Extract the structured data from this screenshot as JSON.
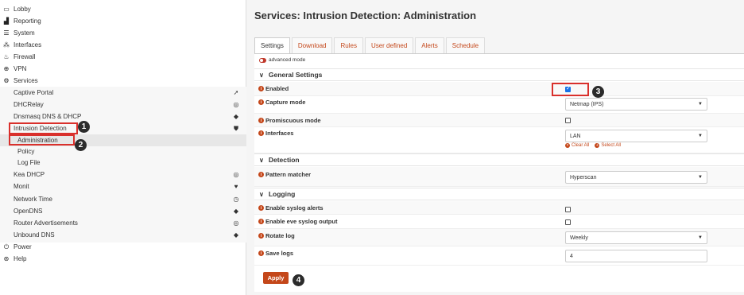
{
  "sidebar": {
    "top_items": [
      {
        "label": "Lobby",
        "icon": "laptop-icon"
      },
      {
        "label": "Reporting",
        "icon": "chart-icon"
      },
      {
        "label": "System",
        "icon": "server-icon"
      },
      {
        "label": "Interfaces",
        "icon": "sitemap-icon"
      },
      {
        "label": "Firewall",
        "icon": "fire-icon"
      },
      {
        "label": "VPN",
        "icon": "globe-icon"
      },
      {
        "label": "Services",
        "icon": "cogs-icon"
      }
    ],
    "services": [
      {
        "label": "Captive Portal",
        "icon": "send-icon"
      },
      {
        "label": "DHCRelay",
        "icon": "target-icon"
      },
      {
        "label": "Dnsmasq DNS & DHCP",
        "icon": "tags-icon"
      },
      {
        "label": "Intrusion Detection",
        "icon": "shield-icon"
      },
      {
        "label": "Administration"
      },
      {
        "label": "Policy"
      },
      {
        "label": "Log File"
      },
      {
        "label": "Kea DHCP",
        "icon": "target-icon"
      },
      {
        "label": "Monit",
        "icon": "heartbeat-icon"
      },
      {
        "label": "Network Time",
        "icon": "clock-icon"
      },
      {
        "label": "OpenDNS",
        "icon": "tags-icon"
      },
      {
        "label": "Router Advertisements",
        "icon": "target-icon"
      },
      {
        "label": "Unbound DNS",
        "icon": "tags-icon"
      }
    ],
    "bottom_items": [
      {
        "label": "Power",
        "icon": "plug-icon"
      },
      {
        "label": "Help",
        "icon": "lifebuoy-icon"
      }
    ]
  },
  "page_title": "Services: Intrusion Detection: Administration",
  "tabs": [
    "Settings",
    "Download",
    "Rules",
    "User defined",
    "Alerts",
    "Schedule"
  ],
  "active_tab": "Settings",
  "advanced_mode_label": "advanced mode",
  "sections": {
    "general": "General Settings",
    "detection": "Detection",
    "logging": "Logging"
  },
  "fields": {
    "enabled": {
      "label": "Enabled",
      "checked": true
    },
    "capture_mode": {
      "label": "Capture mode",
      "value": "Netmap (IPS)"
    },
    "promiscuous": {
      "label": "Promiscuous mode",
      "checked": false
    },
    "interfaces": {
      "label": "Interfaces",
      "value": "LAN",
      "clear_all": "Clear All",
      "select_all": "Select All"
    },
    "pattern_matcher": {
      "label": "Pattern matcher",
      "value": "Hyperscan"
    },
    "syslog_alerts": {
      "label": "Enable syslog alerts",
      "checked": false
    },
    "eve_syslog": {
      "label": "Enable eve syslog output",
      "checked": false
    },
    "rotate_log": {
      "label": "Rotate log",
      "value": "Weekly"
    },
    "save_logs": {
      "label": "Save logs",
      "value": "4"
    }
  },
  "apply_label": "Apply",
  "annotations": [
    "1",
    "2",
    "3",
    "4"
  ],
  "colors": {
    "accent": "#c4471a",
    "annotation_red": "#d9302c",
    "annotation_badge": "#2b2b2b"
  }
}
